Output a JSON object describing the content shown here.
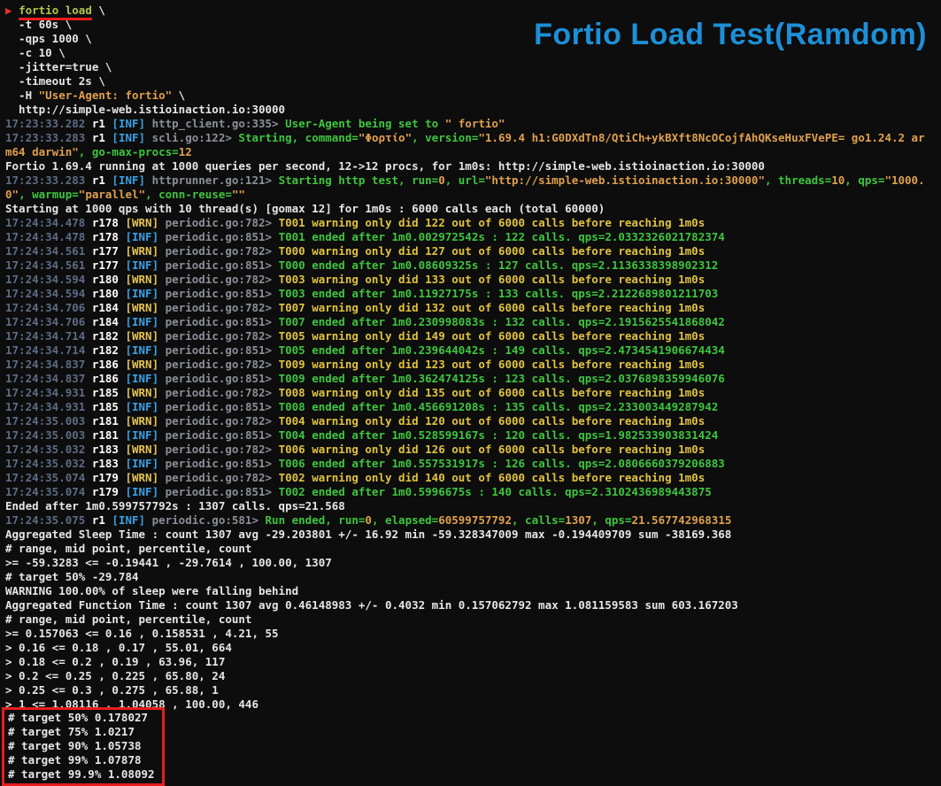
{
  "palette": {
    "background": "#0d0d0d",
    "default_text": "#e6e6e6",
    "timestamp": "#5d6b84",
    "info_blue": "#3aa0e4",
    "warning_yellow": "#e5c453",
    "success_green": "#3ec53e",
    "string_orange": "#dfa04e",
    "annotation_red": "#e71d1d",
    "title_blue": "#1d8fd8"
  },
  "title": {
    "text": "Fortio Load Test(Ramdom)"
  },
  "terminal": {
    "lines": [
      {
        "s": [
          {
            "t": "▶ ",
            "c": "p"
          },
          {
            "t": "fortio load",
            "c": "cmd"
          },
          {
            "t": " \\",
            "c": "w"
          }
        ]
      },
      {
        "s": [
          {
            "t": "  -t 60s \\",
            "c": "w"
          }
        ]
      },
      {
        "s": [
          {
            "t": "  -qps 1000 \\",
            "c": "w"
          }
        ]
      },
      {
        "s": [
          {
            "t": "  -c 10 \\",
            "c": "w"
          }
        ]
      },
      {
        "s": [
          {
            "t": "  -jitter=true \\",
            "c": "w"
          }
        ]
      },
      {
        "s": [
          {
            "t": "  -timeout 2s \\",
            "c": "w"
          }
        ]
      },
      {
        "s": [
          {
            "t": "  -H ",
            "c": "w"
          },
          {
            "t": "\"User-Agent: fortio\"",
            "c": "o"
          },
          {
            "t": " \\",
            "c": "w"
          }
        ]
      },
      {
        "s": [
          {
            "t": "  http://simple-web.istioinaction.io:30000",
            "c": "w"
          }
        ]
      },
      {
        "s": [
          {
            "t": "17:23:33.282 ",
            "c": "ts"
          },
          {
            "t": "r1 ",
            "c": "r"
          },
          {
            "t": "[INF] ",
            "c": "inf"
          },
          {
            "t": "http_client.go:335> ",
            "c": "src"
          },
          {
            "t": "User-Agent being set to ",
            "c": "g"
          },
          {
            "t": "\" fortio\"",
            "c": "o"
          }
        ]
      },
      {
        "s": [
          {
            "t": "17:23:33.283 ",
            "c": "ts"
          },
          {
            "t": "r1 ",
            "c": "r"
          },
          {
            "t": "[INF] ",
            "c": "inf"
          },
          {
            "t": "scli.go:122> ",
            "c": "src"
          },
          {
            "t": "Starting, command=",
            "c": "g"
          },
          {
            "t": "\"Φορτίο\"",
            "c": "o"
          },
          {
            "t": ", version=",
            "c": "g"
          },
          {
            "t": "\"1.69.4 h1:G0DXdTn8/QtiCh+ykBXft8NcOCojfAhQKseHuxFVePE= go1.24.2 ar",
            "c": "o"
          }
        ]
      },
      {
        "s": [
          {
            "t": "m64 darwin\"",
            "c": "o"
          },
          {
            "t": ", go-max-procs=",
            "c": "g"
          },
          {
            "t": "12",
            "c": "o"
          }
        ]
      },
      {
        "s": [
          {
            "t": "Fortio 1.69.4 running at 1000 queries per second, 12->12 procs, for 1m0s: http://simple-web.istioinaction.io:30000",
            "c": "w"
          }
        ]
      },
      {
        "s": [
          {
            "t": "17:23:33.283 ",
            "c": "ts"
          },
          {
            "t": "r1 ",
            "c": "r"
          },
          {
            "t": "[INF] ",
            "c": "inf"
          },
          {
            "t": "httprunner.go:121> ",
            "c": "src"
          },
          {
            "t": "Starting http test, run=",
            "c": "g"
          },
          {
            "t": "0",
            "c": "o"
          },
          {
            "t": ", url=",
            "c": "g"
          },
          {
            "t": "\"http://simple-web.istioinaction.io:30000\"",
            "c": "o"
          },
          {
            "t": ", threads=",
            "c": "g"
          },
          {
            "t": "10",
            "c": "o"
          },
          {
            "t": ", qps=",
            "c": "g"
          },
          {
            "t": "\"1000.",
            "c": "o"
          }
        ]
      },
      {
        "s": [
          {
            "t": "0\"",
            "c": "o"
          },
          {
            "t": ", warmup=",
            "c": "g"
          },
          {
            "t": "\"parallel\"",
            "c": "o"
          },
          {
            "t": ", conn-reuse=",
            "c": "g"
          },
          {
            "t": "\"\"",
            "c": "o"
          }
        ]
      },
      {
        "s": [
          {
            "t": "Starting at 1000 qps with 10 thread(s) [gomax 12] for 1m0s : 6000 calls each (total 60000)",
            "c": "w"
          }
        ]
      },
      {
        "s": [
          {
            "t": "17:24:34.478 ",
            "c": "ts"
          },
          {
            "t": "r178 ",
            "c": "r"
          },
          {
            "t": "[WRN] ",
            "c": "wrn"
          },
          {
            "t": "periodic.go:782> ",
            "c": "src"
          },
          {
            "t": "T001 warning only did 122 out of 6000 calls before reaching 1m0s",
            "c": "y"
          }
        ]
      },
      {
        "s": [
          {
            "t": "17:24:34.478 ",
            "c": "ts"
          },
          {
            "t": "r178 ",
            "c": "r"
          },
          {
            "t": "[INF] ",
            "c": "inf"
          },
          {
            "t": "periodic.go:851> ",
            "c": "src"
          },
          {
            "t": "T001 ended after 1m0.002972542s : 122 calls. qps=2.0332326021782374",
            "c": "g"
          }
        ]
      },
      {
        "s": [
          {
            "t": "17:24:34.561 ",
            "c": "ts"
          },
          {
            "t": "r177 ",
            "c": "r"
          },
          {
            "t": "[WRN] ",
            "c": "wrn"
          },
          {
            "t": "periodic.go:782> ",
            "c": "src"
          },
          {
            "t": "T000 warning only did 127 out of 6000 calls before reaching 1m0s",
            "c": "y"
          }
        ]
      },
      {
        "s": [
          {
            "t": "17:24:34.561 ",
            "c": "ts"
          },
          {
            "t": "r177 ",
            "c": "r"
          },
          {
            "t": "[INF] ",
            "c": "inf"
          },
          {
            "t": "periodic.go:851> ",
            "c": "src"
          },
          {
            "t": "T000 ended after 1m0.08609325s : 127 calls. qps=2.1136338398902312",
            "c": "g"
          }
        ]
      },
      {
        "s": [
          {
            "t": "17:24:34.594 ",
            "c": "ts"
          },
          {
            "t": "r180 ",
            "c": "r"
          },
          {
            "t": "[WRN] ",
            "c": "wrn"
          },
          {
            "t": "periodic.go:782> ",
            "c": "src"
          },
          {
            "t": "T003 warning only did 133 out of 6000 calls before reaching 1m0s",
            "c": "y"
          }
        ]
      },
      {
        "s": [
          {
            "t": "17:24:34.594 ",
            "c": "ts"
          },
          {
            "t": "r180 ",
            "c": "r"
          },
          {
            "t": "[INF] ",
            "c": "inf"
          },
          {
            "t": "periodic.go:851> ",
            "c": "src"
          },
          {
            "t": "T003 ended after 1m0.11927175s : 133 calls. qps=2.2122689801211703",
            "c": "g"
          }
        ]
      },
      {
        "s": [
          {
            "t": "17:24:34.706 ",
            "c": "ts"
          },
          {
            "t": "r184 ",
            "c": "r"
          },
          {
            "t": "[WRN] ",
            "c": "wrn"
          },
          {
            "t": "periodic.go:782> ",
            "c": "src"
          },
          {
            "t": "T007 warning only did 132 out of 6000 calls before reaching 1m0s",
            "c": "y"
          }
        ]
      },
      {
        "s": [
          {
            "t": "17:24:34.706 ",
            "c": "ts"
          },
          {
            "t": "r184 ",
            "c": "r"
          },
          {
            "t": "[INF] ",
            "c": "inf"
          },
          {
            "t": "periodic.go:851> ",
            "c": "src"
          },
          {
            "t": "T007 ended after 1m0.230998083s : 132 calls. qps=2.1915625541868042",
            "c": "g"
          }
        ]
      },
      {
        "s": [
          {
            "t": "17:24:34.714 ",
            "c": "ts"
          },
          {
            "t": "r182 ",
            "c": "r"
          },
          {
            "t": "[WRN] ",
            "c": "wrn"
          },
          {
            "t": "periodic.go:782> ",
            "c": "src"
          },
          {
            "t": "T005 warning only did 149 out of 6000 calls before reaching 1m0s",
            "c": "y"
          }
        ]
      },
      {
        "s": [
          {
            "t": "17:24:34.714 ",
            "c": "ts"
          },
          {
            "t": "r182 ",
            "c": "r"
          },
          {
            "t": "[INF] ",
            "c": "inf"
          },
          {
            "t": "periodic.go:851> ",
            "c": "src"
          },
          {
            "t": "T005 ended after 1m0.239644042s : 149 calls. qps=2.4734541906674434",
            "c": "g"
          }
        ]
      },
      {
        "s": [
          {
            "t": "17:24:34.837 ",
            "c": "ts"
          },
          {
            "t": "r186 ",
            "c": "r"
          },
          {
            "t": "[WRN] ",
            "c": "wrn"
          },
          {
            "t": "periodic.go:782> ",
            "c": "src"
          },
          {
            "t": "T009 warning only did 123 out of 6000 calls before reaching 1m0s",
            "c": "y"
          }
        ]
      },
      {
        "s": [
          {
            "t": "17:24:34.837 ",
            "c": "ts"
          },
          {
            "t": "r186 ",
            "c": "r"
          },
          {
            "t": "[INF] ",
            "c": "inf"
          },
          {
            "t": "periodic.go:851> ",
            "c": "src"
          },
          {
            "t": "T009 ended after 1m0.362474125s : 123 calls. qps=2.0376898359946076",
            "c": "g"
          }
        ]
      },
      {
        "s": [
          {
            "t": "17:24:34.931 ",
            "c": "ts"
          },
          {
            "t": "r185 ",
            "c": "r"
          },
          {
            "t": "[WRN] ",
            "c": "wrn"
          },
          {
            "t": "periodic.go:782> ",
            "c": "src"
          },
          {
            "t": "T008 warning only did 135 out of 6000 calls before reaching 1m0s",
            "c": "y"
          }
        ]
      },
      {
        "s": [
          {
            "t": "17:24:34.931 ",
            "c": "ts"
          },
          {
            "t": "r185 ",
            "c": "r"
          },
          {
            "t": "[INF] ",
            "c": "inf"
          },
          {
            "t": "periodic.go:851> ",
            "c": "src"
          },
          {
            "t": "T008 ended after 1m0.456691208s : 135 calls. qps=2.233003449287942",
            "c": "g"
          }
        ]
      },
      {
        "s": [
          {
            "t": "17:24:35.003 ",
            "c": "ts"
          },
          {
            "t": "r181 ",
            "c": "r"
          },
          {
            "t": "[WRN] ",
            "c": "wrn"
          },
          {
            "t": "periodic.go:782> ",
            "c": "src"
          },
          {
            "t": "T004 warning only did 120 out of 6000 calls before reaching 1m0s",
            "c": "y"
          }
        ]
      },
      {
        "s": [
          {
            "t": "17:24:35.003 ",
            "c": "ts"
          },
          {
            "t": "r181 ",
            "c": "r"
          },
          {
            "t": "[INF] ",
            "c": "inf"
          },
          {
            "t": "periodic.go:851> ",
            "c": "src"
          },
          {
            "t": "T004 ended after 1m0.528599167s : 120 calls. qps=1.982533903831424",
            "c": "g"
          }
        ]
      },
      {
        "s": [
          {
            "t": "17:24:35.032 ",
            "c": "ts"
          },
          {
            "t": "r183 ",
            "c": "r"
          },
          {
            "t": "[WRN] ",
            "c": "wrn"
          },
          {
            "t": "periodic.go:782> ",
            "c": "src"
          },
          {
            "t": "T006 warning only did 126 out of 6000 calls before reaching 1m0s",
            "c": "y"
          }
        ]
      },
      {
        "s": [
          {
            "t": "17:24:35.032 ",
            "c": "ts"
          },
          {
            "t": "r183 ",
            "c": "r"
          },
          {
            "t": "[INF] ",
            "c": "inf"
          },
          {
            "t": "periodic.go:851> ",
            "c": "src"
          },
          {
            "t": "T006 ended after 1m0.557531917s : 126 calls. qps=2.0806660379206883",
            "c": "g"
          }
        ]
      },
      {
        "s": [
          {
            "t": "17:24:35.074 ",
            "c": "ts"
          },
          {
            "t": "r179 ",
            "c": "r"
          },
          {
            "t": "[WRN] ",
            "c": "wrn"
          },
          {
            "t": "periodic.go:782> ",
            "c": "src"
          },
          {
            "t": "T002 warning only did 140 out of 6000 calls before reaching 1m0s",
            "c": "y"
          }
        ]
      },
      {
        "s": [
          {
            "t": "17:24:35.074 ",
            "c": "ts"
          },
          {
            "t": "r179 ",
            "c": "r"
          },
          {
            "t": "[INF] ",
            "c": "inf"
          },
          {
            "t": "periodic.go:851> ",
            "c": "src"
          },
          {
            "t": "T002 ended after 1m0.5996675s : 140 calls. qps=2.3102436989443875",
            "c": "g"
          }
        ]
      },
      {
        "s": [
          {
            "t": "Ended after 1m0.599757792s : 1307 calls. qps=21.568",
            "c": "w"
          }
        ]
      },
      {
        "s": [
          {
            "t": "17:24:35.075 ",
            "c": "ts"
          },
          {
            "t": "r1 ",
            "c": "r"
          },
          {
            "t": "[INF] ",
            "c": "inf"
          },
          {
            "t": "periodic.go:581> ",
            "c": "src"
          },
          {
            "t": "Run ended, run=",
            "c": "g"
          },
          {
            "t": "0",
            "c": "o"
          },
          {
            "t": ", elapsed=",
            "c": "g"
          },
          {
            "t": "60599757792",
            "c": "o"
          },
          {
            "t": ", calls=",
            "c": "g"
          },
          {
            "t": "1307",
            "c": "o"
          },
          {
            "t": ", qps=",
            "c": "g"
          },
          {
            "t": "21.567742968315",
            "c": "o"
          }
        ]
      },
      {
        "s": [
          {
            "t": "Aggregated Sleep Time : count 1307 avg -29.203801 +/- 16.92 min -59.328347009 max -0.194409709 sum -38169.368",
            "c": "w"
          }
        ]
      },
      {
        "s": [
          {
            "t": "# range, mid point, percentile, count",
            "c": "w"
          }
        ]
      },
      {
        "s": [
          {
            "t": ">= -59.3283 <= -0.19441 , -29.7614 , 100.00, 1307",
            "c": "w"
          }
        ]
      },
      {
        "s": [
          {
            "t": "# target 50% -29.784",
            "c": "w"
          }
        ]
      },
      {
        "s": [
          {
            "t": "WARNING 100.00% of sleep were falling behind",
            "c": "w"
          }
        ]
      },
      {
        "s": [
          {
            "t": "Aggregated Function Time : count 1307 avg 0.46148983 +/- 0.4032 min 0.157062792 max 1.081159583 sum 603.167203",
            "c": "w"
          }
        ]
      },
      {
        "s": [
          {
            "t": "# range, mid point, percentile, count",
            "c": "w"
          }
        ]
      },
      {
        "s": [
          {
            "t": ">= 0.157063 <= 0.16 , 0.158531 , 4.21, 55",
            "c": "w"
          }
        ]
      },
      {
        "s": [
          {
            "t": "> 0.16 <= 0.18 , 0.17 , 55.01, 664",
            "c": "w"
          }
        ]
      },
      {
        "s": [
          {
            "t": "> 0.18 <= 0.2 , 0.19 , 63.96, 117",
            "c": "w"
          }
        ]
      },
      {
        "s": [
          {
            "t": "> 0.2 <= 0.25 , 0.225 , 65.80, 24",
            "c": "w"
          }
        ]
      },
      {
        "s": [
          {
            "t": "> 0.25 <= 0.3 , 0.275 , 65.88, 1",
            "c": "w"
          }
        ]
      },
      {
        "s": [
          {
            "t": "> 1 <= 1.08116 , 1.04058 , 100.00, 446",
            "c": "w"
          }
        ]
      },
      {
        "boxed": true,
        "s": [
          {
            "t": "# target 50% 0.178027",
            "c": "w"
          }
        ]
      },
      {
        "boxed": true,
        "s": [
          {
            "t": "# target 75% 1.0217",
            "c": "w"
          }
        ]
      },
      {
        "boxed": true,
        "s": [
          {
            "t": "# target 90% 1.05738",
            "c": "w"
          }
        ]
      },
      {
        "boxed": true,
        "s": [
          {
            "t": "# target 99% 1.07878",
            "c": "w"
          }
        ]
      },
      {
        "boxed": true,
        "s": [
          {
            "t": "# target 99.9% 1.08092",
            "c": "w"
          }
        ]
      }
    ]
  }
}
